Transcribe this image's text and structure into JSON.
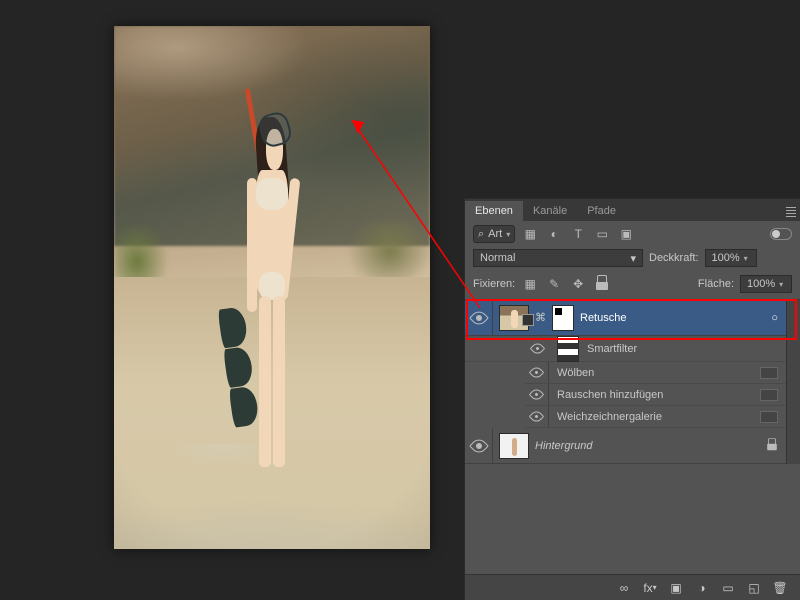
{
  "panel": {
    "tabs": [
      "Ebenen",
      "Kanäle",
      "Pfade"
    ],
    "active_tab": 0,
    "filter_label": "Art",
    "blend_mode": "Normal",
    "opacity_label": "Deckkraft:",
    "opacity_value": "100%",
    "lock_label": "Fixieren:",
    "fill_label": "Fläche:",
    "fill_value": "100%"
  },
  "layers": {
    "selected": {
      "name": "Retusche"
    },
    "smartfilter_label": "Smartfilter",
    "filters": [
      {
        "name": "Wölben"
      },
      {
        "name": "Rauschen hinzufügen"
      },
      {
        "name": "Weichzeichnergalerie"
      }
    ],
    "background": {
      "name": "Hintergrund"
    }
  },
  "icons": {
    "search": "⌕",
    "caret": "▾",
    "image": "▧",
    "adjust": "◐",
    "type": "T",
    "shape": "▭",
    "smart": "▣",
    "eye": "◉",
    "link_chain": "⧉",
    "fx": "fx",
    "mask": "▣",
    "new_fill": "◑",
    "folder": "▢",
    "new": "⧉",
    "trash": "🗑",
    "lock": "🔒",
    "move": "✥",
    "brush": "✎",
    "pixel": "▦",
    "go": "∞",
    "circle": "○"
  }
}
